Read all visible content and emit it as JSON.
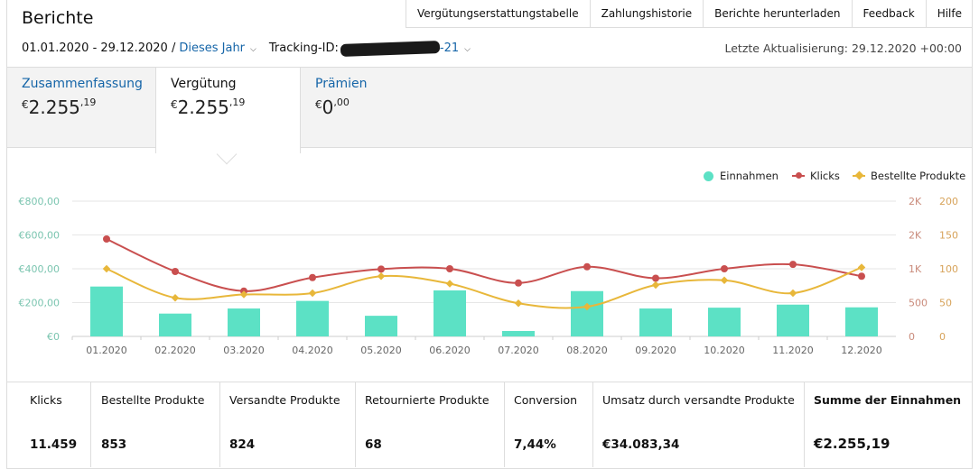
{
  "page": {
    "title": "Berichte"
  },
  "toolbar": [
    "Vergütungserstattungstabelle",
    "Zahlungshistorie",
    "Berichte herunterladen",
    "Feedback",
    "Hilfe"
  ],
  "filter": {
    "date_range": "01.01.2020 - 29.12.2020 /",
    "preset": "Dieses Jahr",
    "tracking_label": "Tracking-ID:",
    "tracking_suffix": "-21"
  },
  "last_update": "Letzte Aktualisierung: 29.12.2020 +00:00",
  "tabs": [
    {
      "label": "Zusammenfassung",
      "currency": "€",
      "value": "2.255",
      "cents": ",19",
      "active": false
    },
    {
      "label": "Vergütung",
      "currency": "€",
      "value": "2.255",
      "cents": ",19",
      "active": true
    },
    {
      "label": "Prämien",
      "currency": "€",
      "value": "0",
      "cents": ",00",
      "active": false
    }
  ],
  "legend": [
    {
      "label": "Einnahmen",
      "color": "#5ce1c5",
      "icon": "dot"
    },
    {
      "label": "Klicks",
      "color": "#c94f4f",
      "icon": "line-circle"
    },
    {
      "label": "Bestellte Produkte",
      "color": "#e8b73a",
      "icon": "line-diamond"
    }
  ],
  "chart_data": {
    "type": "bar",
    "categories": [
      "01.2020",
      "02.2020",
      "03.2020",
      "04.2020",
      "05.2020",
      "06.2020",
      "07.2020",
      "08.2020",
      "09.2020",
      "10.2020",
      "11.2020",
      "12.2020"
    ],
    "series": [
      {
        "name": "Einnahmen",
        "type": "bar",
        "axis": "left",
        "color": "#5ce1c5",
        "values": [
          295,
          135,
          165,
          210,
          122,
          272,
          32,
          268,
          165,
          170,
          188,
          172
        ]
      },
      {
        "name": "Klicks",
        "type": "line",
        "axis": "right1",
        "color": "#c94f4f",
        "values": [
          1440,
          960,
          670,
          870,
          995,
          1000,
          790,
          1030,
          860,
          1000,
          1065,
          890
        ]
      },
      {
        "name": "Bestellte Produkte",
        "type": "line",
        "axis": "right2",
        "color": "#e8b73a",
        "values": [
          100,
          57,
          62,
          64,
          89,
          78,
          49,
          44,
          76,
          83,
          64,
          102
        ]
      }
    ],
    "axes": {
      "left": {
        "ticks": [
          "€0",
          "€200,00",
          "€400,00",
          "€600,00",
          "€800,00"
        ],
        "ylim": [
          0,
          800
        ]
      },
      "right1": {
        "ticks": [
          "0",
          "500",
          "1K",
          "1.5K",
          "2K"
        ],
        "labels": [
          "0",
          "500",
          "1K",
          "2K",
          "2K"
        ],
        "ylim": [
          0,
          2000
        ]
      },
      "right2": {
        "ticks": [
          "0",
          "50",
          "100",
          "150",
          "200"
        ],
        "ylim": [
          0,
          200
        ]
      }
    },
    "grid": true,
    "legend_position": "top-right"
  },
  "metrics": [
    {
      "label": "Klicks",
      "value": "11.459"
    },
    {
      "label": "Bestellte Produkte",
      "value": "853"
    },
    {
      "label": "Versandte Produkte",
      "value": "824"
    },
    {
      "label": "Retournierte Produkte",
      "value": "68"
    },
    {
      "label": "Conversion",
      "value": "7,44%"
    },
    {
      "label": "Umsatz durch versandte Produkte",
      "value": "€34.083,34"
    },
    {
      "label": "Summe der Einnahmen",
      "value": "€2.255,19"
    }
  ]
}
